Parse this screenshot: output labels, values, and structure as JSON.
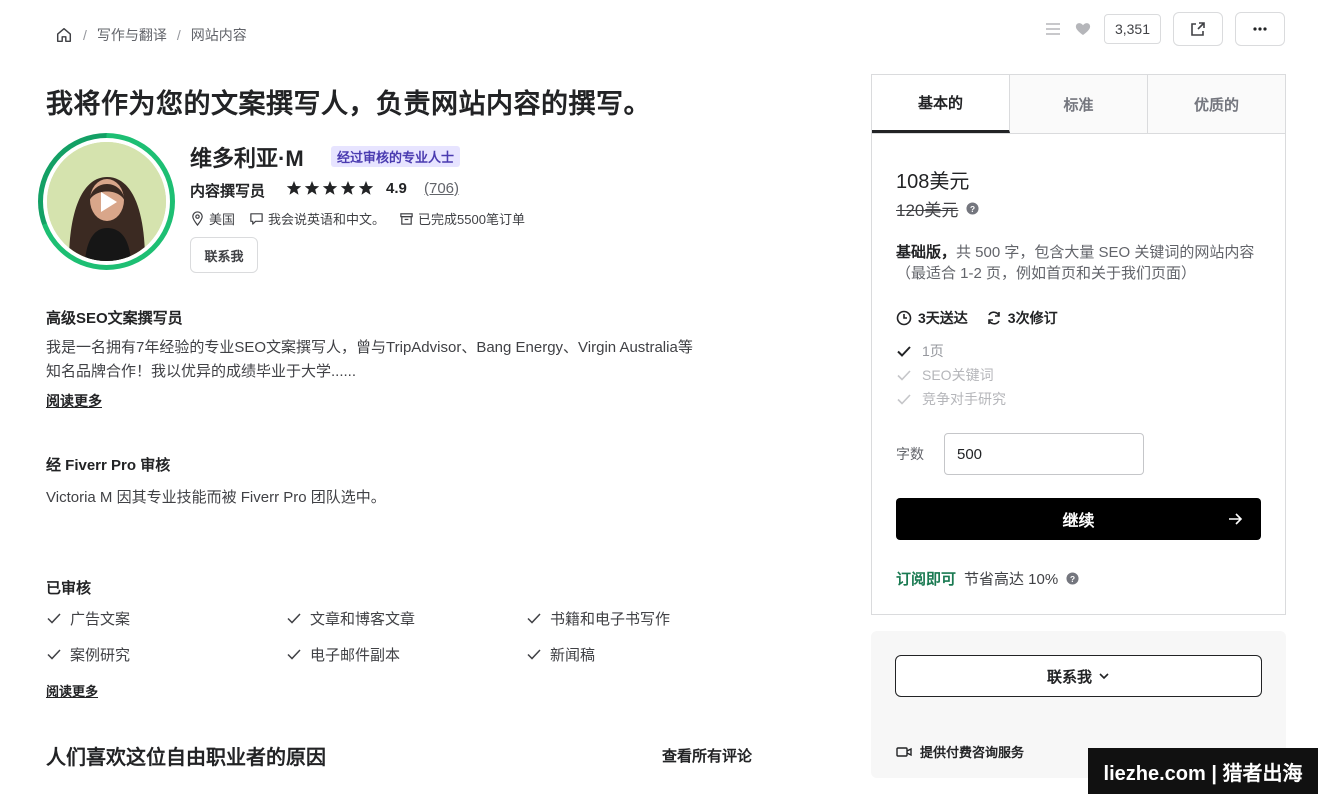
{
  "breadcrumb": {
    "home_icon": "home-icon",
    "items": [
      "写作与翻译",
      "网站内容"
    ]
  },
  "top_actions": {
    "saved_count": "3,351",
    "icons": [
      "list-icon",
      "heart-icon",
      "share-icon",
      "more-icon"
    ]
  },
  "gig": {
    "title": "我将作为您的文案撰写人，负责网站内容的撰写。"
  },
  "seller": {
    "name": "维多利亚·M",
    "badge": "经过审核的专业人士",
    "role": "内容撰写员",
    "rating": "4.9",
    "reviews": "(706)",
    "stars": 5,
    "location": "美国",
    "languages": "我会说英语和中文。",
    "orders": "已完成5500笔订单",
    "contact_label": "联系我"
  },
  "about": {
    "heading": "高级SEO文案撰写员",
    "line1": "我是一名拥有7年经验的专业SEO文案撰写人，曾与TripAdvisor、Bang Energy、Virgin Australia等",
    "line2": "知名品牌合作！我以优异的成绩毕业于大学......",
    "read_more": "阅读更多"
  },
  "pro": {
    "heading": "经 Fiverr Pro 审核",
    "text": "Victoria M 因其专业技能而被 Fiverr Pro 团队选中。"
  },
  "vetted": {
    "heading": "已审核",
    "items": [
      "广告文案",
      "文章和博客文章",
      "书籍和电子书写作",
      "案例研究",
      "电子邮件副本",
      "新闻稿"
    ],
    "read_more": "阅读更多"
  },
  "reasons": {
    "heading": "人们喜欢这位自由职业者的原因",
    "see_all": "查看所有评论"
  },
  "package": {
    "tabs": [
      "基本的",
      "标准",
      "优质的"
    ],
    "active_tab": 0,
    "price": "108美元",
    "old_price": "120美元",
    "desc_bold": "基础版，",
    "desc_text": "共 500 字，包含大量 SEO 关键词的网站内容（最适合 1-2 页，例如首页和关于我们页面）",
    "delivery": "3天送达",
    "revisions": "3次修订",
    "features": [
      {
        "label": "1页",
        "included": true
      },
      {
        "label": "SEO关键词",
        "included": false
      },
      {
        "label": "竞争对手研究",
        "included": false
      }
    ],
    "words_label": "字数",
    "words_value": "500",
    "continue_label": "继续",
    "subscribe_green": "订阅即可",
    "subscribe_text": "节省高达 10%"
  },
  "contact_panel": {
    "contact_label": "联系我",
    "consult_label": "提供付费咨询服务"
  },
  "watermark": "liezhe.com | 猎者出海"
}
